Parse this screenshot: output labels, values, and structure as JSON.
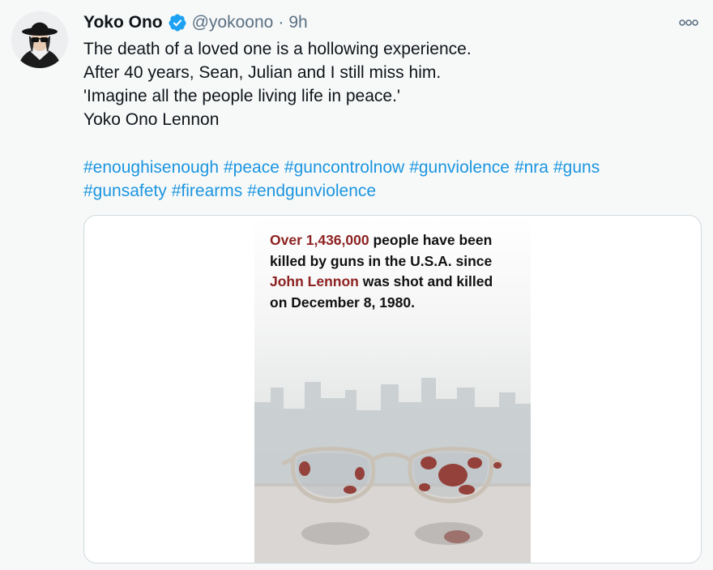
{
  "author": {
    "display_name": "Yoko Ono",
    "handle": "@yokoono",
    "separator": "·",
    "time": "9h",
    "verified": true,
    "avatar_icon": "avatar-photo"
  },
  "tweet": {
    "lines": [
      "The death of a loved one is a hollowing experience.",
      "After 40 years, Sean, Julian and I still miss him.",
      "'Imagine all the people living life in peace.'",
      "Yoko Ono Lennon"
    ],
    "hashtags_row1": [
      "#enoughisenough",
      "#peace",
      "#guncontrolnow",
      "#gunviolence",
      "#nra",
      "#guns"
    ],
    "hashtags_row2": [
      "#gunsafety",
      "#firearms",
      "#endgunviolence"
    ]
  },
  "media": {
    "poster_lines": [
      {
        "red": "Over 1,436,000",
        "rest": " people have been"
      },
      {
        "red": "",
        "rest": "killed by guns in the U.S.A. since"
      },
      {
        "red": "John Lennon",
        "rest": " was shot and killed"
      },
      {
        "red": "",
        "rest": "on December 8, 1980."
      }
    ],
    "image_icon": "bloodied-glasses-photo"
  },
  "colors": {
    "link": "#1b95e0",
    "verified": "#1da1f2",
    "secondary_text": "#5b7083",
    "poster_red": "#8e2222"
  },
  "icons": {
    "more": "more-icon",
    "verified": "verified-badge-icon"
  }
}
